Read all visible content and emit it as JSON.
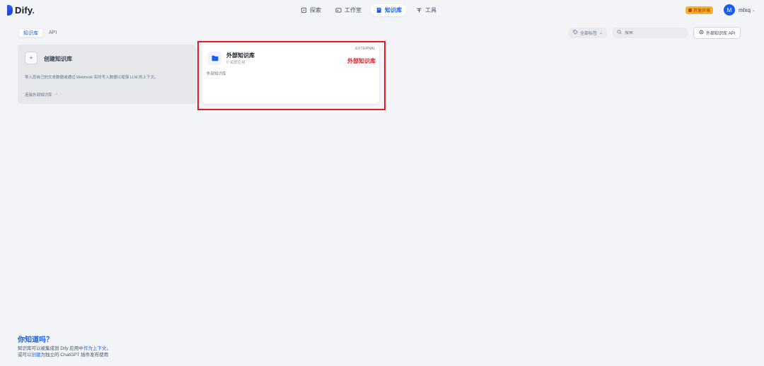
{
  "header": {
    "logo_text": "Dify",
    "logo_dot": ".",
    "nav": [
      {
        "label": "探索",
        "icon": "compass-icon"
      },
      {
        "label": "工作室",
        "icon": "terminal-icon"
      },
      {
        "label": "知识库",
        "icon": "book-icon",
        "active": true
      },
      {
        "label": "工具",
        "icon": "tools-icon"
      }
    ],
    "env_badge": "开发环境",
    "avatar_initial": "M",
    "user_name": "mlxq"
  },
  "tabs": [
    {
      "label": "知识库",
      "active": true
    },
    {
      "label": "API",
      "active": false
    }
  ],
  "toolbar": {
    "tag_filter": "全部标签",
    "search_placeholder": "搜索",
    "ext_api_label": "外部知识库 API"
  },
  "create_card": {
    "plus": "+",
    "title": "创建知识库",
    "description": "导入您自己的文本数据或通过 Webhook 实时写入数据以增强 LLM 的上下文。",
    "link": "连接外部知识库",
    "link_arrow": "→"
  },
  "kb_card": {
    "title": "外部知识库",
    "subtitle": "0 关联应用",
    "badge": "EXTERNAL",
    "annotation": "外部知识库",
    "description": "外部知识库"
  },
  "footer": {
    "title": "你知道吗？",
    "line1_pre": "知识库可以被集成到 Dify 应用中",
    "line1_link": "作为上下文",
    "line1_post": "，",
    "line2_pre": "或可以",
    "line2_link": "创建",
    "line2_post": "为独立的 ChatGPT 插件发布使用"
  },
  "colors": {
    "accent": "#155eef",
    "annotation_red": "#e31b23",
    "env_badge": "#fdb022",
    "background": "#f2f4f7"
  }
}
